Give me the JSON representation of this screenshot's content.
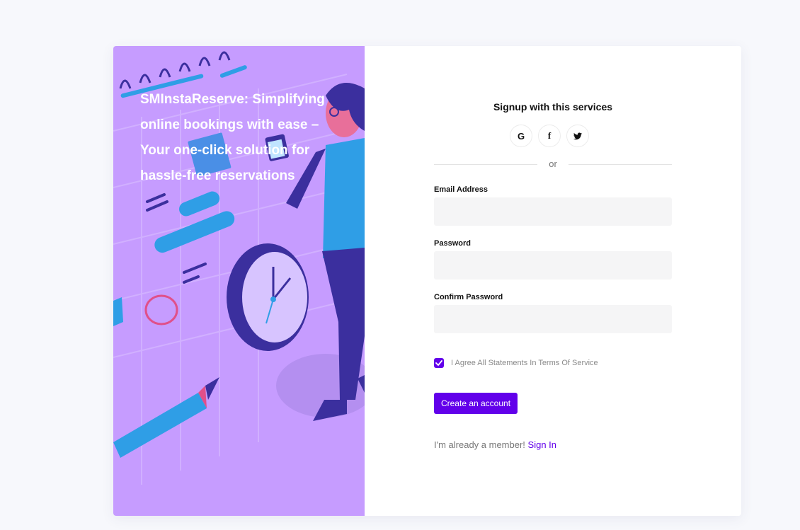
{
  "hero": {
    "tagline": "SMInstaReserve: Simplifying online bookings with ease – Your one-click solution for hassle-free reservations"
  },
  "signup": {
    "title": "Signup with this services",
    "socials": [
      {
        "name": "google",
        "icon": "google-icon",
        "glyph": "G"
      },
      {
        "name": "facebook",
        "icon": "facebook-icon",
        "glyph": "f"
      },
      {
        "name": "twitter",
        "icon": "twitter-icon",
        "glyph": ""
      }
    ],
    "divider_text": "or"
  },
  "form": {
    "email_label": "Email Address",
    "email_value": "",
    "password_label": "Password",
    "password_value": "",
    "confirm_label": "Confirm Password",
    "confirm_value": "",
    "terms_text": "I Agree All Statements In Terms Of Service",
    "terms_checked": true,
    "submit_label": "Create an account"
  },
  "footer": {
    "member_text": "I'm already a member!",
    "signin_label": "Sign In"
  },
  "colors": {
    "accent": "#6200ea",
    "hero_bg": "#c69cff",
    "page_bg": "#f7f8fc"
  }
}
